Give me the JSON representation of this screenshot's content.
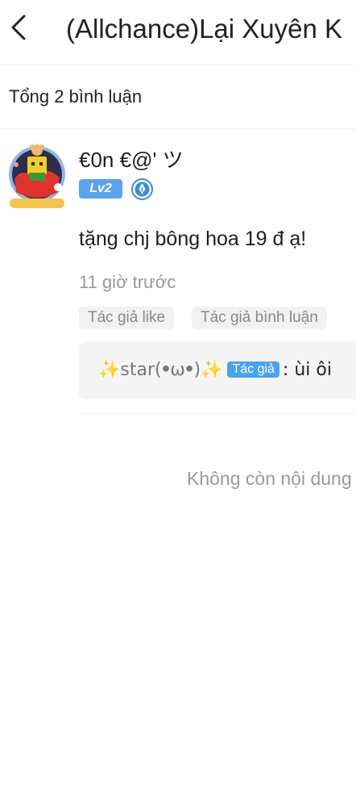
{
  "header": {
    "title": "(Allchance)Lại Xuyên K"
  },
  "summary": {
    "label": "Tổng 2 bình luận"
  },
  "comment": {
    "username": "€0n €@' ツ",
    "level": "Lv2",
    "text": "tặng chj bông hoa 19 đ  ạ!",
    "time": "11 giờ trước",
    "chips": [
      "Tác giả like",
      "Tác giả bình luận"
    ],
    "reply": {
      "author": "✨star(ꔷωꔷ)✨",
      "author_tag": "Tác giả",
      "text": ": ùi ôi"
    }
  },
  "footer": {
    "end_text": "Không còn nội dung"
  },
  "colors": {
    "accent": "#5aa3ef",
    "muted": "#9a9a9a",
    "chip_bg": "#f2f2f2"
  }
}
